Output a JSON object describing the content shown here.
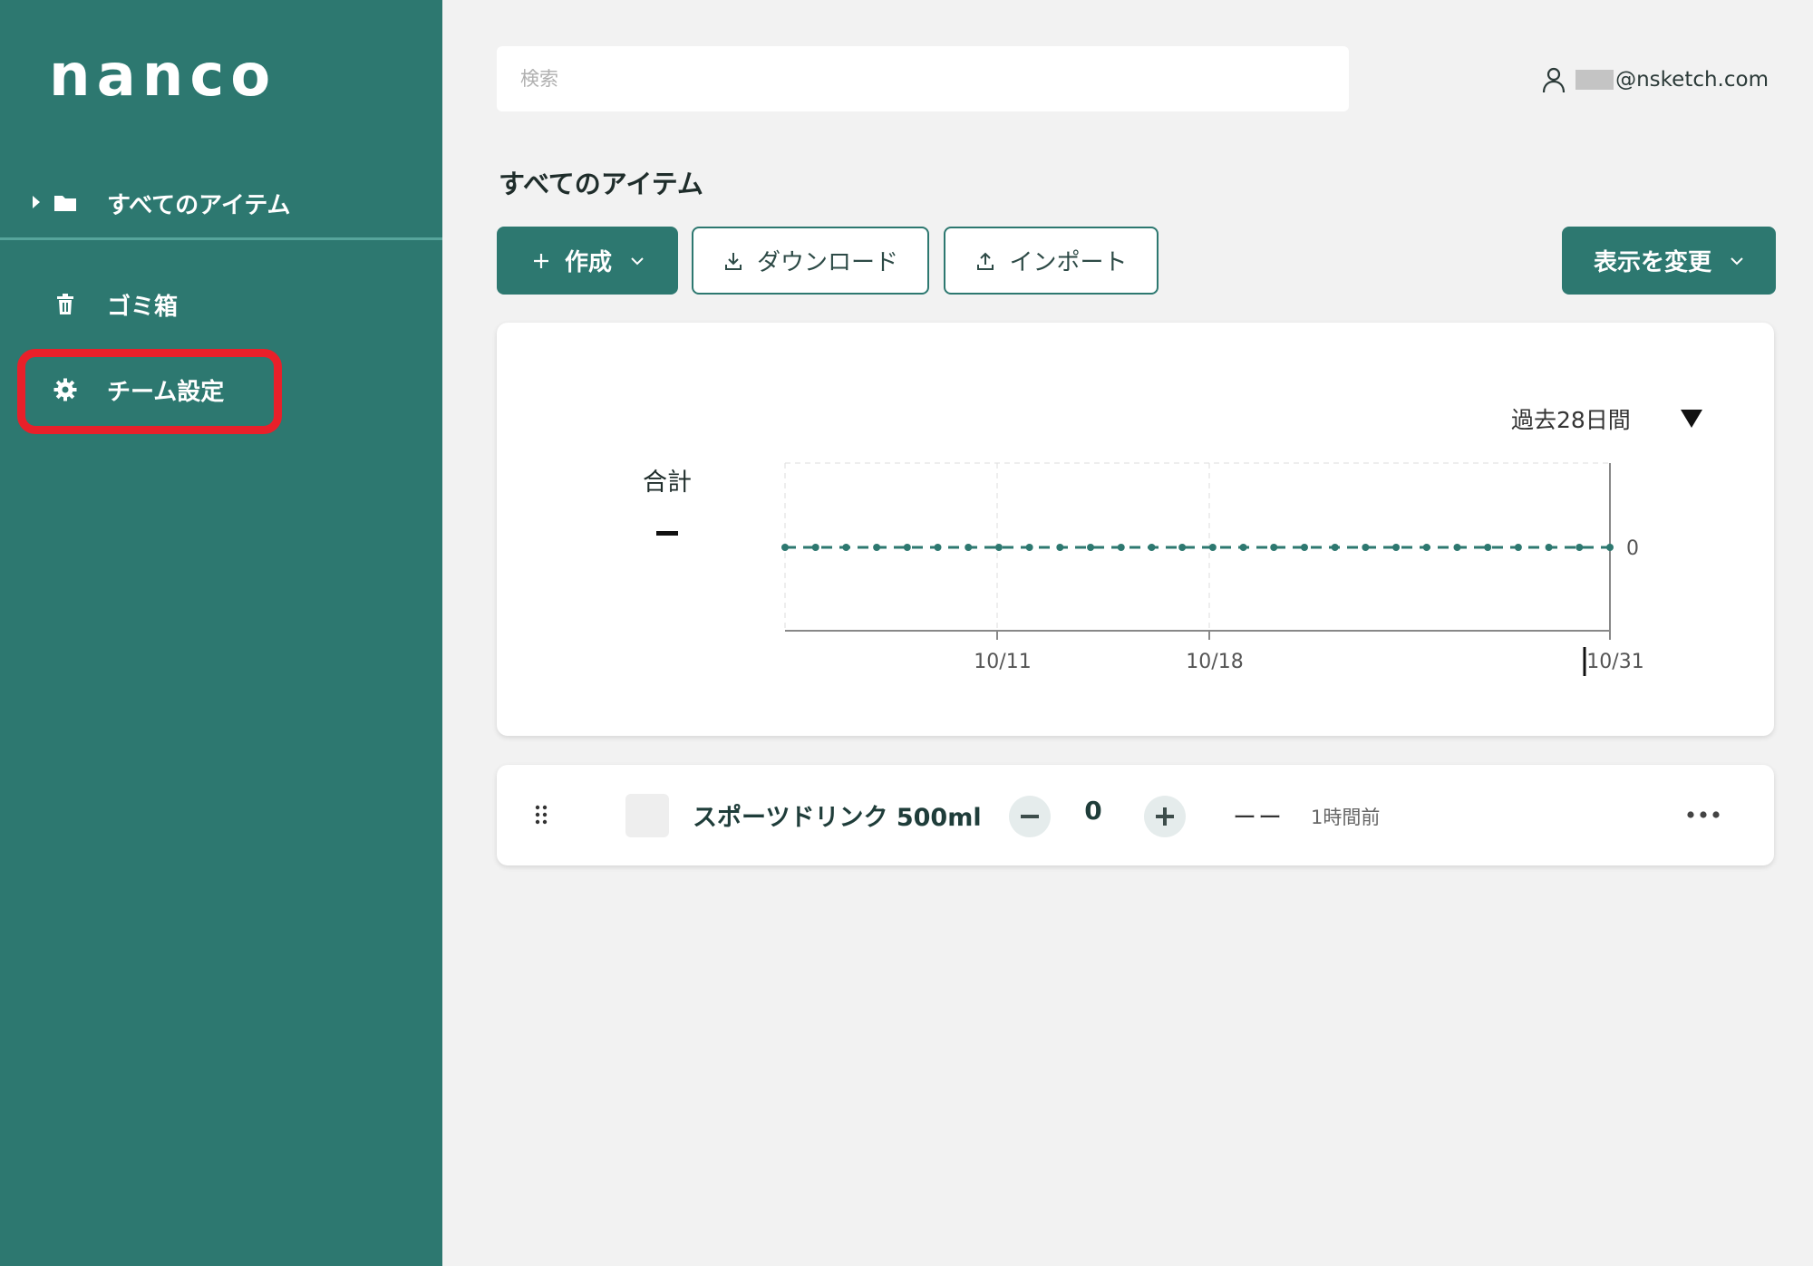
{
  "app": {
    "logo": "nanco"
  },
  "sidebar": {
    "items": [
      {
        "label": "すべてのアイテム",
        "icon": "folder-icon",
        "expandable": true
      },
      {
        "label": "ゴミ箱",
        "icon": "trash-icon"
      },
      {
        "label": "チーム設定",
        "icon": "gear-icon",
        "highlighted": true
      }
    ]
  },
  "header": {
    "search_placeholder": "検索",
    "user_email": "@nsketch.com"
  },
  "main": {
    "title": "すべてのアイテム",
    "toolbar": {
      "create_label": "作成",
      "download_label": "ダウンロード",
      "import_label": "インポート",
      "view_label": "表示を変更"
    },
    "chart_card": {
      "period": "過去28日間",
      "total_label": "合計",
      "total_value": "–"
    },
    "items": [
      {
        "name": "スポーツドリンク 500ml",
        "quantity": "0",
        "value_text": "ーー",
        "updated": "1時間前"
      }
    ]
  },
  "colors": {
    "brand": "#2d7870",
    "highlight": "#e8202a",
    "background": "#f2f2f2"
  },
  "chart_data": {
    "type": "line",
    "x_ticks": [
      "10/11",
      "10/18",
      "10/31"
    ],
    "y_ticks": [
      "0"
    ],
    "points": 28,
    "values": [
      0,
      0,
      0,
      0,
      0,
      0,
      0,
      0,
      0,
      0,
      0,
      0,
      0,
      0,
      0,
      0,
      0,
      0,
      0,
      0,
      0,
      0,
      0,
      0,
      0,
      0,
      0,
      0
    ],
    "color": "#2d7870",
    "line_style": "dashed",
    "grid": true
  }
}
